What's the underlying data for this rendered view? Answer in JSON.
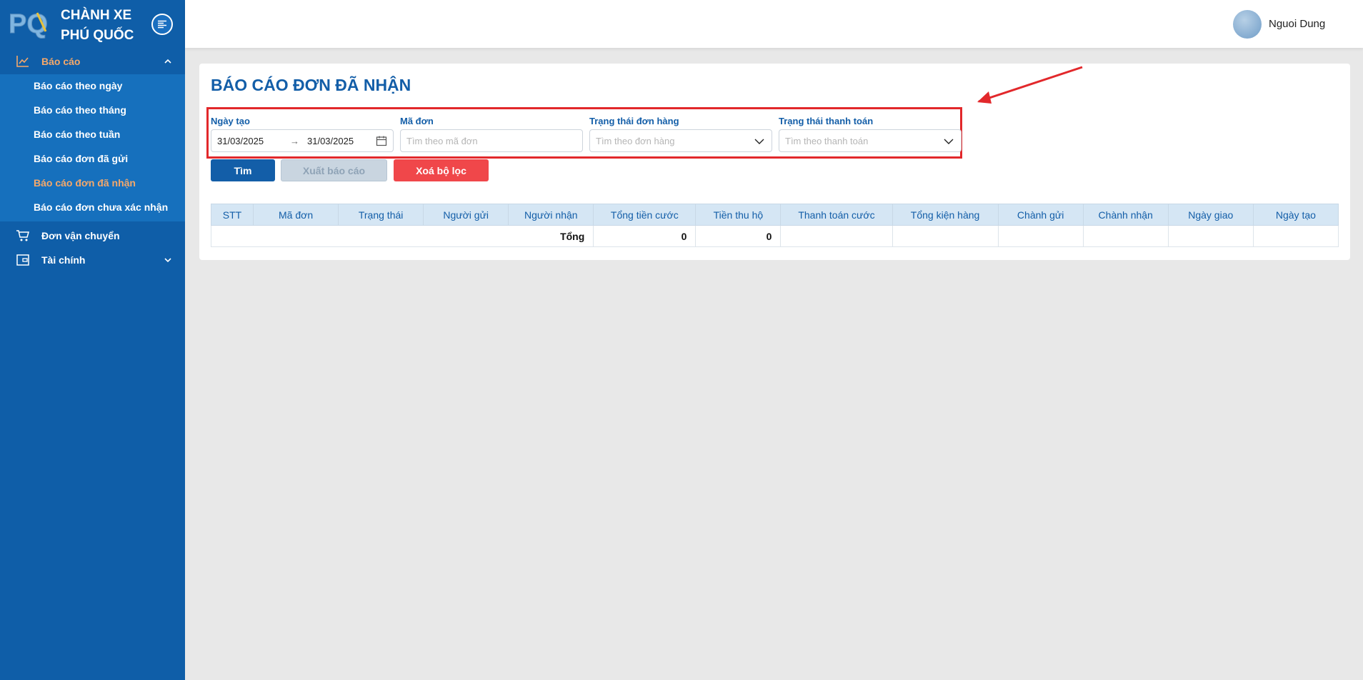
{
  "brand": {
    "name_line1": "CHÀNH XE",
    "name_line2": "PHÚ QUỐC",
    "logo_text": "PQ"
  },
  "sidebar": {
    "groups": [
      {
        "label": "Báo cáo",
        "icon": "line-chart-icon"
      },
      {
        "label": "Đơn vận chuyển",
        "icon": "cart-icon"
      },
      {
        "label": "Tài chính",
        "icon": "wallet-icon"
      }
    ],
    "report_items": [
      "Báo cáo theo ngày",
      "Báo cáo theo tháng",
      "Báo cáo theo tuần",
      "Báo cáo đơn đã gửi",
      "Báo cáo đơn đã nhận",
      "Báo cáo đơn chưa xác nhận"
    ],
    "active_item": "Báo cáo đơn đã nhận"
  },
  "header": {
    "user_name": "Nguoi Dung"
  },
  "page": {
    "title": "BÁO CÁO ĐƠN ĐÃ NHẬN"
  },
  "filters": {
    "date_label": "Ngày tạo",
    "date_from": "31/03/2025",
    "date_to": "31/03/2025",
    "code_label": "Mã đơn",
    "code_placeholder": "Tìm theo mã đơn",
    "order_status_label": "Trạng thái đơn hàng",
    "order_status_placeholder": "Tìm theo đơn hàng",
    "payment_status_label": "Trạng thái thanh toán",
    "payment_status_placeholder": "Tìm theo thanh toán"
  },
  "buttons": {
    "search": "Tìm",
    "export": "Xuất báo cáo",
    "clear": "Xoá bộ lọc"
  },
  "table": {
    "columns": [
      "STT",
      "Mã đơn",
      "Trạng thái",
      "Người gửi",
      "Người nhận",
      "Tổng tiền cước",
      "Tiền thu hộ",
      "Thanh toán cước",
      "Tổng kiện hàng",
      "Chành gửi",
      "Chành nhận",
      "Ngày giao",
      "Ngày tạo"
    ],
    "total_label": "Tổng",
    "total_freight": "0",
    "total_cod": "0"
  },
  "colors": {
    "sidebar": "#0f5ea8",
    "accent": "#135ea8",
    "active": "#f5a86a",
    "danger": "#f0474a",
    "highlight": "#e2282b"
  }
}
